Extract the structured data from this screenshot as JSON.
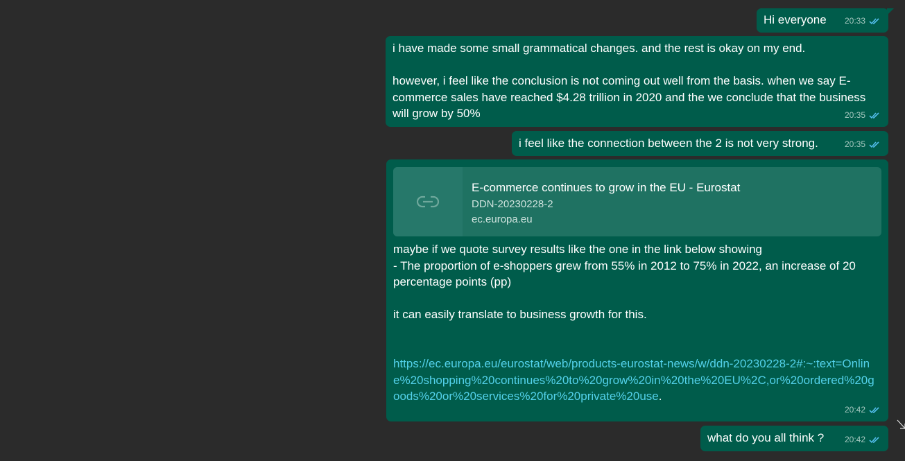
{
  "messages": [
    {
      "text": "Hi everyone",
      "time": "20:33"
    },
    {
      "text": "i have made some small grammatical changes. and the rest is okay on my end.\n\nhowever, i feel like the conclusion is not coming out well from the basis. when we say E-commerce sales have reached $4.28 trillion in 2020 and the we conclude that the business will grow by 50%",
      "time": "20:35"
    },
    {
      "text": "i feel like the connection between the 2 is not very strong.",
      "time": "20:35"
    },
    {
      "preview": {
        "title": "E-commerce continues to grow in the EU - Eurostat",
        "description": "DDN-20230228-2",
        "domain": "ec.europa.eu",
        "icon": "link-icon"
      },
      "text": "maybe if we quote survey results like the one in the link below showing\n- The proportion of e-shoppers grew from 55% in 2012 to 75% in 2022, an increase of 20 percentage points (pp)\n\nit can easily translate to business growth for this.",
      "link": "https://ec.europa.eu/eurostat/web/products-eurostat-news/w/ddn-20230228-2#:~:text=Online%20shopping%20continues%20to%20grow%20in%20the%20EU%2C,or%20ordered%20goods%20or%20services%20for%20private%20use",
      "link_suffix": ".",
      "time": "20:42"
    },
    {
      "text": "what do you all think ?",
      "time": "20:42"
    }
  ],
  "status_icon": "double-check-read-icon",
  "colors": {
    "background": "#2b2b2b",
    "bubble": "#005c4b",
    "link": "#53d1ea",
    "read_ticks": "#53bdeb"
  }
}
